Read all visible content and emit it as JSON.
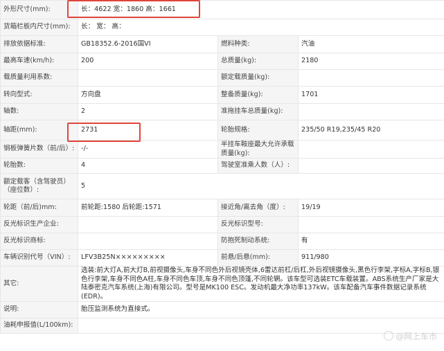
{
  "rows": [
    {
      "l1": "外形尺寸(mm):",
      "v1": "长：4622 宽：1860 高：1661",
      "merge": true
    },
    {
      "l1": "货箱栏板内尺寸(mm):",
      "v1": "长：  宽：  高：",
      "merge": true
    },
    {
      "l1": "排放依据标准:",
      "v1": "GB18352.6-2016国VI",
      "l2": "燃料种类:",
      "v2": "汽油"
    },
    {
      "l1": "最高车速(km/h):",
      "v1": "200",
      "l2": "总质量(kg):",
      "v2": "2180"
    },
    {
      "l1": "载质量利用系数:",
      "v1": "",
      "l2": "额定载质量(kg):",
      "v2": ""
    },
    {
      "l1": "转向型式:",
      "v1": "方向盘",
      "l2": "整备质量(kg):",
      "v2": "1701"
    },
    {
      "l1": "轴数:",
      "v1": "2",
      "l2": "准拖挂车总质量(kg):",
      "v2": ""
    },
    {
      "l1": "轴距(mm):",
      "v1": "2731",
      "l2": "轮胎规格:",
      "v2": "235/50 R19,235/45 R20"
    },
    {
      "l1": "钢板弹簧片数（前/后）:",
      "v1": "-/-",
      "l2": "半挂车鞍座最大允许承载质量(kg):",
      "v2": ""
    },
    {
      "l1": "轮胎数:",
      "v1": "4",
      "l2": "驾驶室准乘人数（人）:",
      "v2": ""
    },
    {
      "l1": "额定载客（含驾驶员）（座位数）:",
      "v1": "5",
      "merge": true
    },
    {
      "l1": "轮距（前/后)mm:",
      "v1": "前轮距:1580 后轮距:1571",
      "l2": "接近角/离去角（度）:",
      "v2": "19/19"
    },
    {
      "l1": "反光标识生产企业:",
      "v1": "",
      "l2": "反光标识型号:",
      "v2": ""
    },
    {
      "l1": "反光标识商标:",
      "v1": "",
      "l2": "防抱死制动系统:",
      "v2": "有"
    },
    {
      "l1": "车辆识别代号（VIN）:",
      "v1": "LFV3B25N×××××××××",
      "l2": "前悬/后悬(mm):",
      "v2": "911/980"
    },
    {
      "l1": "其它:",
      "v1": "选装:前大灯A,前大灯B,前视摄像头,车身不同色外后视镜壳体,6雷达前杠/后杠,外后视镜摄像头,黑色行李架,字标A,字标B,银色行李架,车身不同色A柱,车身不同色车顶,车身不同色顶篷,不同轮辋。该车型可选装ETC车载装置。ABS系统生产厂家是大陆泰密克汽车系统(上海)有限公司。型号是MK100 ESC。发动机最大净功率137kW。该车配备汽车事件数据记录系统(EDR)。",
      "merge": true
    },
    {
      "l1": "说明:",
      "v1": "胎压监测系统为直接式。",
      "merge": true
    },
    {
      "l1": "油耗申报值(L/100km):",
      "v1": "",
      "merge": true
    }
  ],
  "watermark": "@网上车市"
}
